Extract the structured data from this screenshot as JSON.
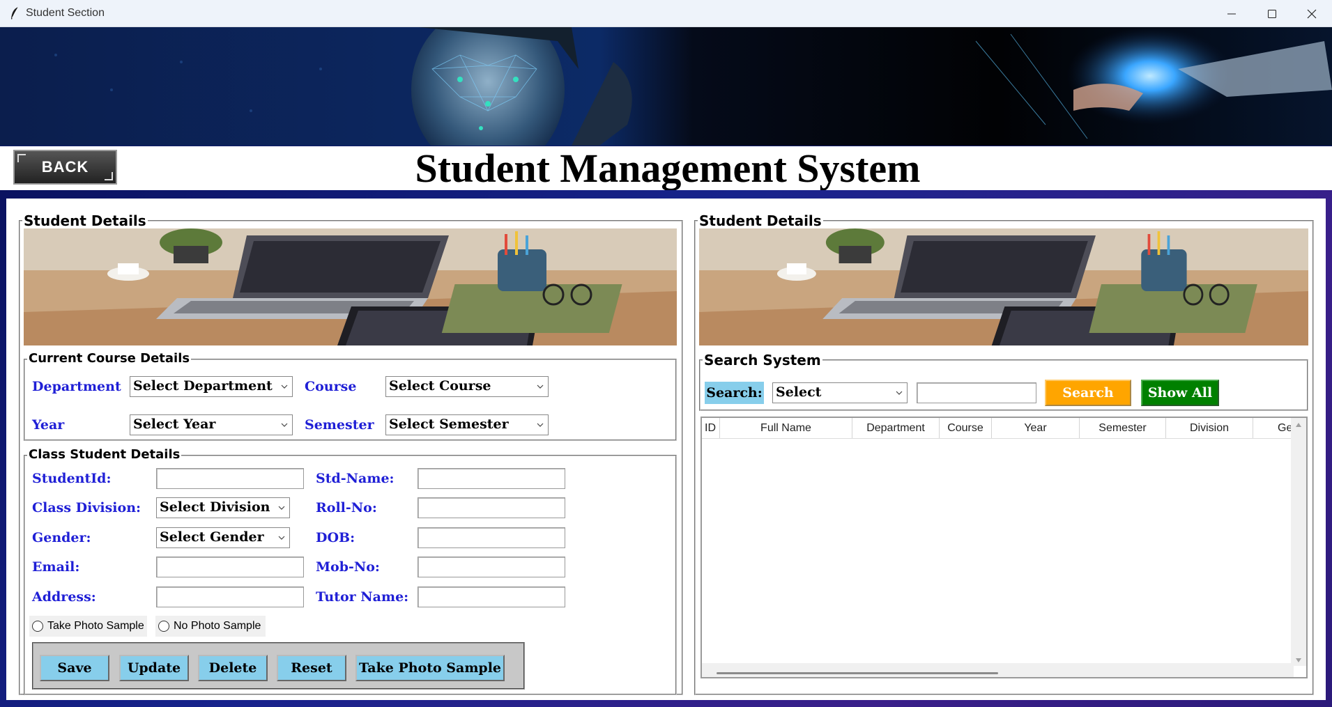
{
  "window": {
    "title": "Student Section"
  },
  "header": {
    "back_label": "BACK",
    "title": "Student Management System"
  },
  "left_panel": {
    "title": "Student Details",
    "course": {
      "title": "Current Course Details",
      "department_label": "Department",
      "department_value": "Select Department",
      "course_label": "Course",
      "course_value": "Select Course",
      "year_label": "Year",
      "year_value": "Select Year",
      "semester_label": "Semester",
      "semester_value": "Select Semester"
    },
    "class": {
      "title": "Class Student Details",
      "student_id_label": "StudentId:",
      "std_name_label": "Std-Name:",
      "division_label": "Class Division:",
      "division_value": "Select Division",
      "roll_label": "Roll-No:",
      "gender_label": "Gender:",
      "gender_value": "Select Gender",
      "dob_label": "DOB:",
      "email_label": "Email:",
      "mob_label": "Mob-No:",
      "address_label": "Address:",
      "tutor_label": "Tutor Name:",
      "radio_take": "Take Photo Sample",
      "radio_no": "No Photo Sample"
    },
    "buttons": {
      "save": "Save",
      "update": "Update",
      "delete": "Delete",
      "reset": "Reset",
      "take_photo": "Take Photo Sample"
    }
  },
  "right_panel": {
    "title": "Student Details",
    "search": {
      "title": "Search System",
      "label": "Search:",
      "select_value": "Select",
      "search_button": "Search",
      "show_all_button": "Show All"
    },
    "table": {
      "columns": [
        "ID",
        "Full Name",
        "Department",
        "Course",
        "Year",
        "Semester",
        "Division",
        "Gender"
      ]
    }
  },
  "colors": {
    "label_blue": "#1f1fd6",
    "button_sky": "#87ceeb",
    "search_orange": "#ffa500",
    "show_all_green": "#008000"
  }
}
